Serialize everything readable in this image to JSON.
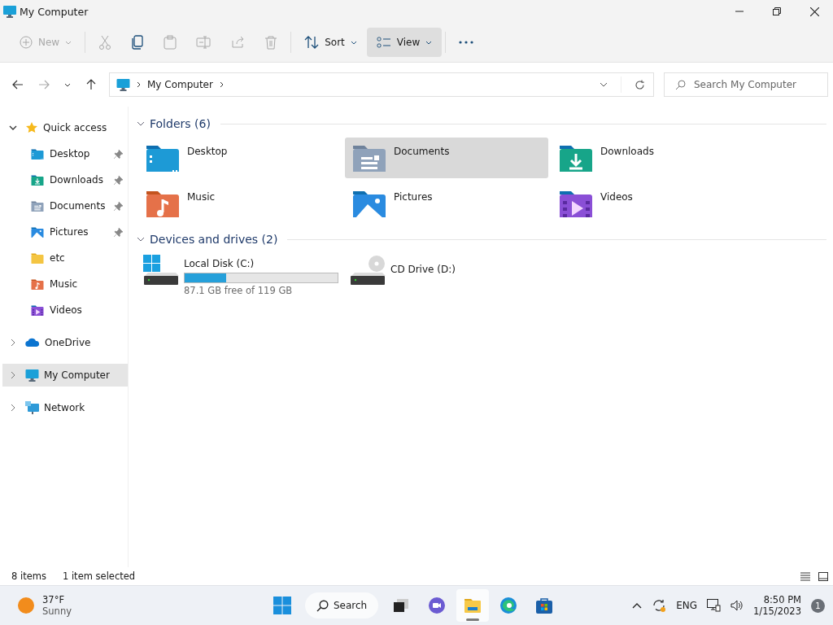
{
  "window": {
    "title": "My Computer"
  },
  "toolbar": [
    {
      "kind": "new",
      "label": "New",
      "disabled": true
    },
    {
      "kind": "cut",
      "disabled": true
    },
    {
      "kind": "copy",
      "disabled": false
    },
    {
      "kind": "paste",
      "disabled": true
    },
    {
      "kind": "rename",
      "disabled": true
    },
    {
      "kind": "share",
      "disabled": true
    },
    {
      "kind": "delete",
      "disabled": true
    },
    {
      "kind": "sort",
      "label": "Sort",
      "disabled": false,
      "hovered": false
    },
    {
      "kind": "view",
      "label": "View",
      "disabled": false,
      "hovered": true
    },
    {
      "kind": "more",
      "disabled": false
    }
  ],
  "navigation": {
    "back_disabled": false,
    "forward_disabled": true
  },
  "address": {
    "path": [
      "My Computer"
    ]
  },
  "search": {
    "placeholder": "Search My Computer"
  },
  "sidebar": {
    "items": [
      {
        "label": "Quick access",
        "kind": "star",
        "expanded": true,
        "selected": false,
        "children": [
          {
            "label": "Desktop",
            "kind": "desktop",
            "pinned": true,
            "selected": false
          },
          {
            "label": "Downloads",
            "kind": "downloads",
            "pinned": true,
            "selected": false
          },
          {
            "label": "Documents",
            "kind": "documents",
            "pinned": true,
            "selected": false
          },
          {
            "label": "Pictures",
            "kind": "pictures",
            "pinned": true,
            "selected": false
          },
          {
            "label": "etc",
            "kind": "folder",
            "pinned": false,
            "selected": false
          },
          {
            "label": "Music",
            "kind": "music",
            "pinned": false,
            "selected": false
          },
          {
            "label": "Videos",
            "kind": "videos",
            "pinned": false,
            "selected": false
          }
        ]
      },
      {
        "label": "OneDrive",
        "kind": "cloud",
        "expanded": false,
        "selected": false
      },
      {
        "label": "My Computer",
        "kind": "computer",
        "expanded": false,
        "selected": true
      },
      {
        "label": "Network",
        "kind": "network",
        "expanded": false,
        "selected": false
      }
    ]
  },
  "sections": [
    {
      "title": "Folders (6)",
      "expanded": true,
      "items": [
        {
          "kind": "desktop",
          "name": "Desktop",
          "selected": false
        },
        {
          "kind": "documents",
          "name": "Documents",
          "selected": true
        },
        {
          "kind": "downloads",
          "name": "Downloads",
          "selected": false
        },
        {
          "kind": "music",
          "name": "Music",
          "selected": false
        },
        {
          "kind": "pictures",
          "name": "Pictures",
          "selected": false
        },
        {
          "kind": "videos",
          "name": "Videos",
          "selected": false
        }
      ]
    },
    {
      "title": "Devices and drives (2)",
      "expanded": true,
      "items": [
        {
          "kind": "disk",
          "name": "Local Disk (C:)",
          "level": 0.27,
          "detail": "87.1 GB free of 119 GB",
          "selected": false
        },
        {
          "kind": "cd",
          "name": "CD Drive (D:)",
          "selected": false
        }
      ]
    }
  ],
  "status_bar": {
    "count": "8 items",
    "selection": "1 item selected"
  },
  "taskbar": {
    "weather": {
      "temperature": "37°F",
      "condition": "Sunny"
    },
    "apps": [
      {
        "kind": "start",
        "active": false
      },
      {
        "kind": "search",
        "label": "Search",
        "active": false
      },
      {
        "kind": "taskview",
        "active": false
      },
      {
        "kind": "chat",
        "active": false
      },
      {
        "kind": "explorer",
        "active": true
      },
      {
        "kind": "edge",
        "active": false
      },
      {
        "kind": "store",
        "active": false
      }
    ],
    "language": "ENG",
    "time": "8:50 PM",
    "date": "1/15/2023",
    "notifications": "1"
  }
}
